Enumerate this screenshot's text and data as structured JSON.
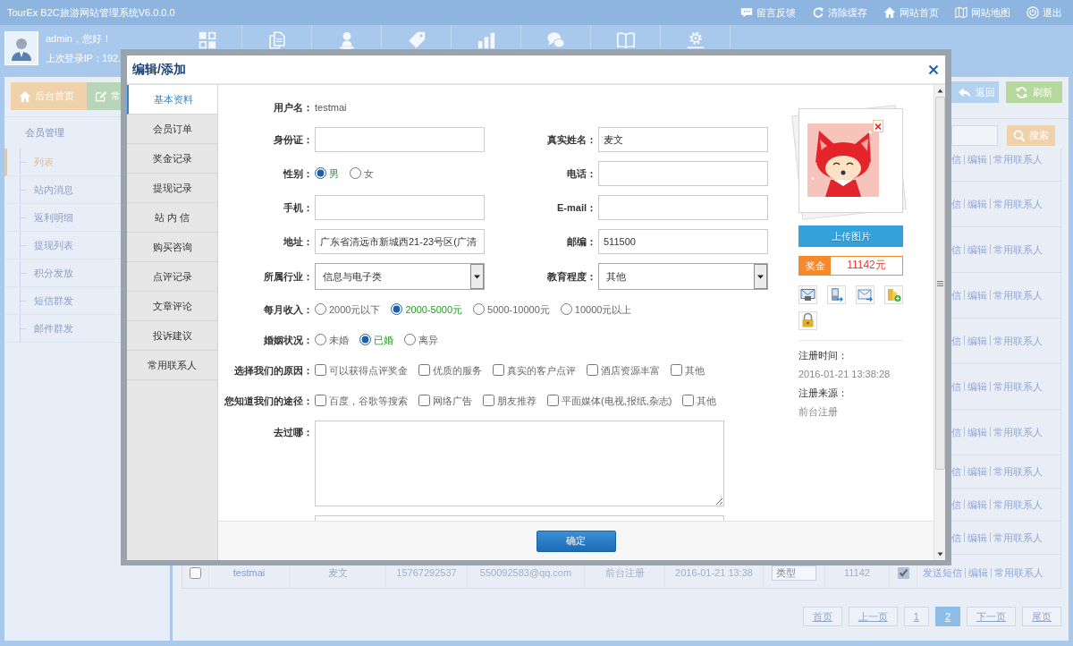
{
  "top_bar": {
    "title": "TourEx B2C旅游网站管理系统V6.0.0.0",
    "links": [
      {
        "label": "留言反馈"
      },
      {
        "label": "清除缓存"
      },
      {
        "label": "网站首页"
      },
      {
        "label": "网站地图"
      },
      {
        "label": "退出"
      }
    ]
  },
  "user": {
    "greeting": "admin，您好！",
    "last_login": "上次登录IP：192."
  },
  "sidebar": {
    "buttons": [
      {
        "label": "后台首页"
      },
      {
        "label": "常"
      }
    ],
    "menu_title": "会员管理",
    "items": [
      {
        "label": "列表",
        "selected": true
      },
      {
        "label": "站内消息",
        "selected": false
      },
      {
        "label": "返利明细",
        "selected": false
      },
      {
        "label": "提现列表",
        "selected": false
      },
      {
        "label": "积分发放",
        "selected": false
      },
      {
        "label": "短信群发",
        "selected": false
      },
      {
        "label": "邮件群发",
        "selected": false
      }
    ]
  },
  "toolbar": {
    "buttons": [
      {
        "label": "返回"
      },
      {
        "label": "刷新"
      }
    ],
    "search_button": "搜索"
  },
  "table": {
    "partial_rows": [
      {
        "actions": [
          "信",
          "编辑",
          "常用联系人"
        ]
      },
      {
        "actions": [
          "信",
          "编辑",
          "常用联系人"
        ]
      },
      {
        "actions": [
          "信",
          "编辑",
          "常用联系人"
        ]
      },
      {
        "actions": [
          "信",
          "编辑",
          "常用联系人"
        ]
      },
      {
        "actions": [
          "信",
          "编辑",
          "常用联系人"
        ]
      },
      {
        "actions": [
          "信",
          "编辑",
          "常用联系人"
        ]
      },
      {
        "actions": [
          "信",
          "编辑",
          "常用联系人"
        ]
      },
      {
        "actions": [
          "信",
          "编辑",
          "常用联系人"
        ]
      },
      {
        "actions": [
          "信",
          "编辑",
          "常用联系人"
        ]
      },
      {
        "actions": [
          "信",
          "编辑",
          "常用联系人"
        ]
      }
    ],
    "row": {
      "checked": false,
      "cells": [
        "testmai",
        "麦文",
        "15767292537",
        "550092583@qq.com",
        "前台注册",
        "2016-01-21 13:38"
      ],
      "type": "类型",
      "bonus": "11142",
      "flag_checked": true,
      "actions": [
        "发送短信",
        "编辑",
        "常用联系人"
      ]
    }
  },
  "pagination": [
    {
      "label": "首页",
      "selected": false
    },
    {
      "label": "上一页",
      "selected": false
    },
    {
      "label": "1",
      "selected": false
    },
    {
      "label": "2",
      "selected": true
    },
    {
      "label": "下一页",
      "selected": false
    },
    {
      "label": "尾页",
      "selected": false
    }
  ],
  "dialog": {
    "title": "编辑/添加",
    "tabs": [
      {
        "label": "基本资料",
        "selected": true
      },
      {
        "label": "会员订单",
        "selected": false
      },
      {
        "label": "奖金记录",
        "selected": false
      },
      {
        "label": "提现记录",
        "selected": false
      },
      {
        "label": "站 内 信",
        "selected": false
      },
      {
        "label": "购买咨询",
        "selected": false
      },
      {
        "label": "点评记录",
        "selected": false
      },
      {
        "label": "文章评论",
        "selected": false
      },
      {
        "label": "投诉建议",
        "selected": false
      },
      {
        "label": "常用联系人",
        "selected": false
      }
    ],
    "form": [
      {
        "fields": [
          {
            "kind": "static",
            "label": "用户名：",
            "value": "testmai"
          }
        ]
      },
      {
        "fields": [
          {
            "kind": "input",
            "label": "身份证："
          },
          {
            "kind": "input",
            "label": "真实姓名：",
            "value": "麦文"
          }
        ]
      },
      {
        "fields": [
          {
            "kind": "radio",
            "label": "性别：",
            "options": [
              {
                "label": "男",
                "selected": true
              },
              {
                "label": "女",
                "selected": false
              }
            ]
          },
          {
            "kind": "input",
            "label": "电话："
          }
        ]
      },
      {
        "fields": [
          {
            "kind": "input",
            "label": "手机："
          },
          {
            "kind": "input",
            "label": "E-mail："
          }
        ]
      },
      {
        "fields": [
          {
            "kind": "input",
            "label": "地址：",
            "value": "广东省清远市新城西21-23号区(广清"
          },
          {
            "kind": "input",
            "label": "邮编：",
            "value": "511500"
          }
        ]
      },
      {
        "fields": [
          {
            "kind": "select",
            "label": "所属行业：",
            "value": "信息与电子类"
          },
          {
            "kind": "select",
            "label": "教育程度：",
            "value": "其他"
          }
        ]
      },
      {
        "fields": [
          {
            "kind": "radio",
            "label": "每月收入：",
            "options": [
              {
                "label": "2000元以下",
                "selected": false
              },
              {
                "label": "2000-5000元",
                "selected": true
              },
              {
                "label": "5000-10000元",
                "selected": false
              },
              {
                "label": "10000元以上",
                "selected": false
              }
            ]
          }
        ]
      },
      {
        "fields": [
          {
            "kind": "radio",
            "label": "婚姻状况：",
            "options": [
              {
                "label": "未婚",
                "selected": false
              },
              {
                "label": "已婚",
                "selected": true
              },
              {
                "label": "离异",
                "selected": false
              }
            ]
          }
        ]
      },
      {
        "fields": [
          {
            "kind": "checkbox",
            "label": "选择我们的原因：",
            "options": [
              {
                "label": "可以获得点评奖金",
                "checked": false
              },
              {
                "label": "优质的服务",
                "checked": false
              },
              {
                "label": "真实的客户点评",
                "checked": false
              },
              {
                "label": "酒店资源丰富",
                "checked": false
              },
              {
                "label": "其他",
                "checked": false
              }
            ]
          }
        ]
      },
      {
        "fields": [
          {
            "kind": "checkbox",
            "label": "您知道我们的途径：",
            "options": [
              {
                "label": "百度，谷歌等搜索",
                "checked": false
              },
              {
                "label": "网络广告",
                "checked": false
              },
              {
                "label": "朋友推荐",
                "checked": false
              },
              {
                "label": "平面媒体(电视,报纸,杂志)",
                "checked": false
              },
              {
                "label": "其他",
                "checked": false
              }
            ]
          }
        ]
      },
      {
        "fields": [
          {
            "kind": "textarea",
            "label": "去过哪：",
            "cut": false
          }
        ]
      },
      {
        "fields": [
          {
            "kind": "textarea",
            "cut": true
          }
        ]
      }
    ],
    "profile": {
      "upload_button": "上传图片",
      "bonus_label": "奖金",
      "bonus_value": "11142元",
      "info": [
        {
          "label": "注册时间：",
          "value": "2016-01-21 13:38:28"
        },
        {
          "label": "注册来源：",
          "value": "前台注册"
        }
      ]
    },
    "confirm_button": "确定"
  }
}
